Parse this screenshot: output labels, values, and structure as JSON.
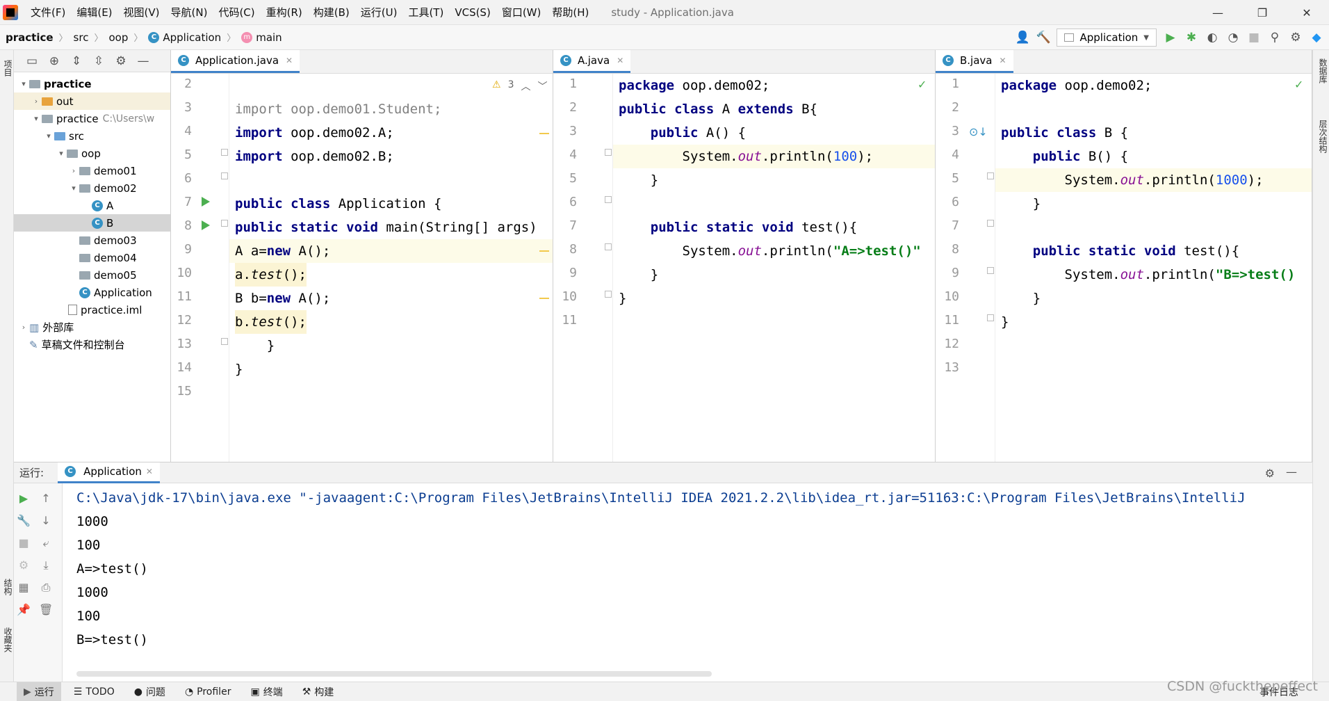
{
  "menubar": {
    "items": [
      "文件(F)",
      "编辑(E)",
      "视图(V)",
      "导航(N)",
      "代码(C)",
      "重构(R)",
      "构建(B)",
      "运行(U)",
      "工具(T)",
      "VCS(S)",
      "窗口(W)",
      "帮助(H)"
    ],
    "title": "study - Application.java"
  },
  "navbar": {
    "crumbs": [
      "practice",
      "src",
      "oop",
      "Application",
      "main"
    ],
    "run_config": "Application"
  },
  "left_strip": {
    "top_label": "项目",
    "mid_label": "结构",
    "bottom_label": "收藏夹"
  },
  "right_strip": {
    "top_label": "数据库",
    "mid_label": "层次结构"
  },
  "project_tree": [
    {
      "label": "practice"
    },
    {
      "label": "out"
    },
    {
      "label": "practice",
      "hint": "C:\\Users\\w"
    },
    {
      "label": "src"
    },
    {
      "label": "oop"
    },
    {
      "label": "demo01"
    },
    {
      "label": "demo02"
    },
    {
      "label": "A"
    },
    {
      "label": "B"
    },
    {
      "label": "demo03"
    },
    {
      "label": "demo04"
    },
    {
      "label": "demo05"
    },
    {
      "label": "Application"
    },
    {
      "label": "practice.iml"
    },
    {
      "label": "外部库"
    },
    {
      "label": "草稿文件和控制台"
    }
  ],
  "editors": {
    "app": {
      "tab": "Application.java",
      "warning_count": "3",
      "line_numbers": [
        "2",
        "3",
        "4",
        "5",
        "6",
        "7",
        "8",
        "9",
        "10",
        "11",
        "12",
        "13",
        "14",
        "15"
      ]
    },
    "a": {
      "tab": "A.java",
      "line_numbers": [
        "1",
        "2",
        "3",
        "4",
        "5",
        "6",
        "7",
        "8",
        "9",
        "10",
        "11"
      ]
    },
    "b": {
      "tab": "B.java",
      "line_numbers": [
        "1",
        "2",
        "3",
        "4",
        "5",
        "6",
        "7",
        "8",
        "9",
        "10",
        "11",
        "12",
        "13"
      ]
    }
  },
  "code": {
    "app_l3_a": "import",
    "app_l3_b": " oop.demo01.Student;",
    "app_l4_a": "import",
    "app_l4_b": " oop.demo02.A;",
    "app_l5_a": "import",
    "app_l5_b": " oop.demo02.B;",
    "app_l7_a": "public class",
    "app_l7_b": " Application {",
    "app_l8_a": "public static void",
    "app_l8_b": " main(String[] args)",
    "app_l9_a": "A a=",
    "app_l9_b": "new",
    "app_l9_c": " A();",
    "app_l10_a": "a.",
    "app_l10_b": "test",
    "app_l10_c": "();",
    "app_l11_a": "B b=",
    "app_l11_b": "new",
    "app_l11_c": " A();",
    "app_l12_a": "b.",
    "app_l12_b": "test",
    "app_l12_c": "();",
    "app_l13": "    }",
    "app_l14": "}",
    "a_l1_a": "package",
    "a_l1_b": " oop.demo02;",
    "a_l2_a": "public class",
    "a_l2_b": " A ",
    "a_l2_c": "extends",
    "a_l2_d": " B{",
    "a_l3_a": "    public",
    "a_l3_b": " A() {",
    "a_l4_a": "        System.",
    "a_l4_b": "out",
    "a_l4_c": ".println(",
    "a_l4_d": "100",
    "a_l4_e": ");",
    "a_l5": "    }",
    "a_l7_a": "    public static void",
    "a_l7_b": " test(){",
    "a_l8_a": "        System.",
    "a_l8_b": "out",
    "a_l8_c": ".println(",
    "a_l8_d": "\"A=>test()\"",
    "a_l9": "    }",
    "a_l10": "}",
    "b_l1_a": "package",
    "b_l1_b": " oop.demo02;",
    "b_l3_a": "public class",
    "b_l3_b": " B {",
    "b_l4_a": "    public",
    "b_l4_b": " B() {",
    "b_l5_a": "        System.",
    "b_l5_b": "out",
    "b_l5_c": ".println(",
    "b_l5_d": "1000",
    "b_l5_e": ");",
    "b_l6": "    }",
    "b_l8_a": "    public static void",
    "b_l8_b": " test(){",
    "b_l9_a": "        System.",
    "b_l9_b": "out",
    "b_l9_c": ".println(",
    "b_l9_d": "\"B=>test()",
    "b_l10": "    }",
    "b_l11": "}"
  },
  "run": {
    "label": "运行:",
    "tab": "Application",
    "console": [
      "C:\\Java\\jdk-17\\bin\\java.exe \"-javaagent:C:\\Program Files\\JetBrains\\IntelliJ IDEA 2021.2.2\\lib\\idea_rt.jar=51163:C:\\Program Files\\JetBrains\\IntelliJ",
      "1000",
      "100",
      "A=>test()",
      "1000",
      "100",
      "B=>test()"
    ]
  },
  "statusbar": {
    "items": [
      "运行",
      "TODO",
      "问题",
      "Profiler",
      "终端",
      "构建"
    ],
    "right": "事件日志"
  },
  "watermark": "CSDN @fuckthepeffect"
}
